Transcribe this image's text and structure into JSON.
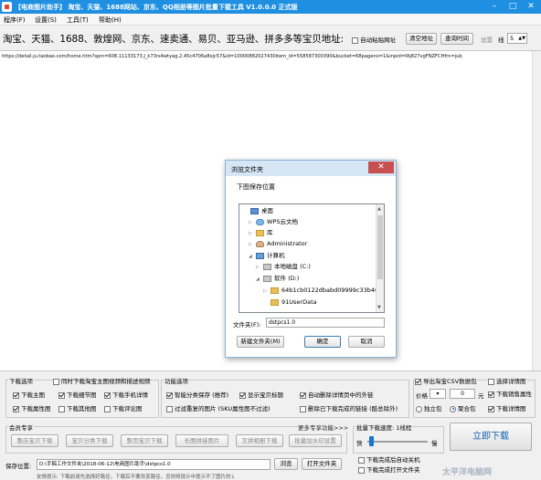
{
  "window": {
    "title": "【电商图片助手】 淘宝、天猫、1688网站、京东、QQ相册等图片批量下载工具 V1.0.0.0 正式版",
    "minimize": "–",
    "maximize": "□",
    "close": "✕",
    "accent_color": "#1e8fe1"
  },
  "menu": {
    "items": [
      "程序(F)",
      "设置(S)",
      "工具(T)",
      "帮助(H)"
    ]
  },
  "url_bar": {
    "label": "淘宝、天猫、1688、敦煌网、京东、速卖通、易贝、亚马逊、拼多多等宝贝地址:",
    "auto_paste_label": "自动粘贴网址",
    "clear_button": "清空地址",
    "query_time_button": "查询时间",
    "settings_button": "设置",
    "count_label": "线",
    "count_value": "5"
  },
  "url_text": "https://detail.ju.taobao.com/home.htm?spm=608.11133173.J_k73rs4wtyag.2.45c4706a8xjc57&id=10000882027430item_id=558587300390&bucket=68pageno=1&inpid=fAj827vgFNZFCHfrn=jub",
  "dialog": {
    "title": "浏览文件夹",
    "close": "✕",
    "prompt": "下图保存位置",
    "tree": [
      {
        "label": "桌面",
        "level": 0,
        "expander": ""
      },
      {
        "label": "WPS云文档",
        "level": 1,
        "expander": "▷"
      },
      {
        "label": "库",
        "level": 1,
        "expander": "▷"
      },
      {
        "label": "Administrator",
        "level": 1,
        "expander": "▷"
      },
      {
        "label": "计算机",
        "level": 1,
        "expander": "◢"
      },
      {
        "label": "本地磁盘 (C:)",
        "level": 2,
        "expander": "▷"
      },
      {
        "label": "软件 (D:)",
        "level": 2,
        "expander": "◢"
      },
      {
        "label": "64b1cb0122dbabd09999c33b40",
        "level": 3,
        "expander": "▷"
      },
      {
        "label": "91UserData",
        "level": 3,
        "expander": ""
      }
    ],
    "folder_label": "文件夹(F):",
    "folder_value": "dstpcs1.0",
    "new_folder_button": "新建文件夹(M)",
    "ok_button": "确定",
    "cancel_button": "取消"
  },
  "download_options": {
    "title": "下载选项",
    "sync_label": "同时下载淘宝主图视频和描述视频",
    "items": [
      {
        "label": "下载主图",
        "checked": true
      },
      {
        "label": "下载细节图",
        "checked": true
      },
      {
        "label": "下载手机详情",
        "checked": true
      },
      {
        "label": "下载属性图",
        "checked": true
      },
      {
        "label": "下载其他图",
        "checked": false
      },
      {
        "label": "下载评论图",
        "checked": false
      }
    ]
  },
  "function_options": {
    "title": "功能选项",
    "items": [
      {
        "label": "智能分类保存 (推荐)",
        "checked": true
      },
      {
        "label": "显示宝贝标题",
        "checked": true
      },
      {
        "label": "自动删除详情页中的外链",
        "checked": true
      },
      {
        "label": "过滤重复的图片 (SKU属性图不过滤)",
        "checked": false
      },
      {
        "label": "删除已下载完成的链接 (酷总除外)",
        "checked": false
      }
    ]
  },
  "right_options": {
    "export_csv": "导出淘宝CSV数据包",
    "detail_label": "选择详情图",
    "price_label": "价格",
    "price_value": "0",
    "unit": "元",
    "download_attr": "下载销售属性",
    "single_store": "独立包",
    "merge": "聚合包",
    "download_detail": "下载详情图"
  },
  "member": {
    "title": "会员专享",
    "more": "更多专享功能>>>",
    "buttons": [
      "整店宝贝下载",
      "宝贝分类下载",
      "整页宝贝下载",
      "长图拼接图片",
      "叉拼相册下载",
      "批量加水印设置"
    ]
  },
  "speed": {
    "title": "批量下载速度: 1线程",
    "slow": "快",
    "fast": "慢"
  },
  "start_button": "立即下载",
  "footer": {
    "save_label": "保存位置:",
    "save_path": "D:\\手稿工作文件夹\\2018-06-12\\电商图片助手\\dstpcs1.0",
    "browse_button": "浏览",
    "open_folder_button": "打开文件夹",
    "tip": "友情提示: 下载前请先选择好路径，下载后不要改变路径，否则将提示中提示不了图片的↓",
    "done_close": "下载完成后自动关机",
    "done_open": "下载完成打开文件夹",
    "watermark": "太平洋电脑网"
  }
}
